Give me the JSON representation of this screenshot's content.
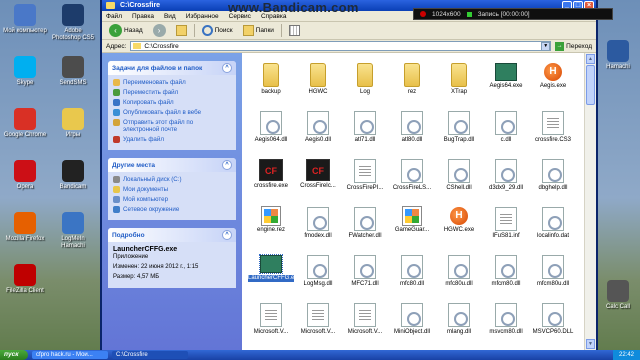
{
  "watermark": "www.Bandicam.com",
  "recorder": {
    "resolution": "1024x600",
    "status": "Запись [00:00:00]"
  },
  "desktop_left": [
    {
      "label": "Мой компьютер",
      "icon": "my-computer-icon",
      "color": "#4a78c8"
    },
    {
      "label": "Adobe Photoshop CS5",
      "icon": "photoshop-icon",
      "color": "#1d3c6b"
    },
    {
      "label": "Skype",
      "icon": "skype-icon",
      "color": "#00aff0"
    },
    {
      "label": "SendSMS",
      "icon": "sendsms-icon",
      "color": "#4c4c4c"
    },
    {
      "label": "Google Chrome",
      "icon": "chrome-icon",
      "color": "#d93025"
    },
    {
      "label": "Игры",
      "icon": "folder-icon",
      "color": "#e9c84d"
    },
    {
      "label": "Opera",
      "icon": "opera-icon",
      "color": "#cc0f16"
    },
    {
      "label": "Bandicam",
      "icon": "bandicam-icon",
      "color": "#222222"
    },
    {
      "label": "Mozilla Firefox",
      "icon": "firefox-icon",
      "color": "#e66000"
    },
    {
      "label": "LogMeIn Hamachi",
      "icon": "hamachi-icon",
      "color": "#3b75c4"
    },
    {
      "label": "FileZilla Client",
      "icon": "filezilla-icon",
      "color": "#bf0000"
    }
  ],
  "desktop_right": [
    {
      "label": "Hamachi",
      "icon": "app-icon",
      "color": "#2c5aa0"
    },
    {
      "label": "Calc Call",
      "icon": "calc-icon",
      "color": "#555555"
    }
  ],
  "window": {
    "title": "C:\\Crossfire",
    "menu": [
      "Файл",
      "Правка",
      "Вид",
      "Избранное",
      "Сервис",
      "Справка"
    ],
    "toolbar": {
      "back": "Назад",
      "search": "Поиск",
      "folders": "Папки"
    },
    "address_label": "Адрес:",
    "address_value": "C:\\Crossfire",
    "go_label": "Переход"
  },
  "taskpane": {
    "tasks_title": "Задачи для файлов и папок",
    "tasks": [
      "Переименовать файл",
      "Переместить файл",
      "Копировать файл",
      "Опубликовать файл в вебе",
      "Отправить этот файл по электронной почте",
      "Удалить файл"
    ],
    "places_title": "Другие места",
    "places": [
      "Локальный диск (C:)",
      "Мои документы",
      "Мой компьютер",
      "Сетевое окружение"
    ],
    "details_title": "Подробно",
    "details": {
      "name": "LauncherCFFG.exe",
      "type": "Приложение",
      "modified": "Изменен: 22 июня 2012 г., 1:15",
      "size": "Размер: 4,57 МБ"
    }
  },
  "files": [
    {
      "name": "backup",
      "kind": "folder"
    },
    {
      "name": "HGWC",
      "kind": "folder"
    },
    {
      "name": "Log",
      "kind": "folder"
    },
    {
      "name": "rez",
      "kind": "folder"
    },
    {
      "name": "XTrap",
      "kind": "folder"
    },
    {
      "name": "Aegis64.exe",
      "kind": "exe-app"
    },
    {
      "name": "Aegis.exe",
      "kind": "exe-h"
    },
    {
      "name": "Aegis064.dll",
      "kind": "dll"
    },
    {
      "name": "Aegis0.dll",
      "kind": "dll"
    },
    {
      "name": "atl71.dll",
      "kind": "dll"
    },
    {
      "name": "atl80.dll",
      "kind": "dll"
    },
    {
      "name": "BugTrap.dll",
      "kind": "dll"
    },
    {
      "name": "c.dll",
      "kind": "dll"
    },
    {
      "name": "crossfire.CS3",
      "kind": "doc"
    },
    {
      "name": "crossfire.exe",
      "kind": "exe-cf"
    },
    {
      "name": "CrossFireIc...",
      "kind": "exe-cf"
    },
    {
      "name": "CrossFirePI...",
      "kind": "doc"
    },
    {
      "name": "CrossFireLS...",
      "kind": "dll"
    },
    {
      "name": "CShell.dll",
      "kind": "dll"
    },
    {
      "name": "d3dx9_29.dll",
      "kind": "dll"
    },
    {
      "name": "dbghelp.dll",
      "kind": "dll"
    },
    {
      "name": "engine.rez",
      "kind": "exe-win"
    },
    {
      "name": "fmodex.dll",
      "kind": "dll"
    },
    {
      "name": "FWatcher.dll",
      "kind": "dll"
    },
    {
      "name": "GameGuar...",
      "kind": "exe-win"
    },
    {
      "name": "HGWC.exe",
      "kind": "exe-h"
    },
    {
      "name": "IFuS81.inf",
      "kind": "doc"
    },
    {
      "name": "localinfo.dat",
      "kind": "dll"
    },
    {
      "name": "LauncherCFFG.exe",
      "kind": "exe-app",
      "selected": true
    },
    {
      "name": "LogMsg.dll",
      "kind": "dll"
    },
    {
      "name": "MFC71.dll",
      "kind": "dll"
    },
    {
      "name": "mfc80.dll",
      "kind": "dll"
    },
    {
      "name": "mfc80u.dll",
      "kind": "dll"
    },
    {
      "name": "mfcm80.dll",
      "kind": "dll"
    },
    {
      "name": "mfcm80u.dll",
      "kind": "dll"
    },
    {
      "name": "Microsoft.V...",
      "kind": "doc"
    },
    {
      "name": "Microsoft.V...",
      "kind": "doc"
    },
    {
      "name": "Microsoft.V...",
      "kind": "doc"
    },
    {
      "name": "MiniObject.dll",
      "kind": "dll"
    },
    {
      "name": "mlang.dll",
      "kind": "dll"
    },
    {
      "name": "msvcm80.dll",
      "kind": "dll"
    },
    {
      "name": "MSVCP60.DLL",
      "kind": "dll"
    }
  ],
  "taskbar": {
    "start": "пуск",
    "items": [
      "cfpro hack.ru - Мои...",
      "C:\\Crossfire"
    ],
    "clock": "22:42"
  }
}
